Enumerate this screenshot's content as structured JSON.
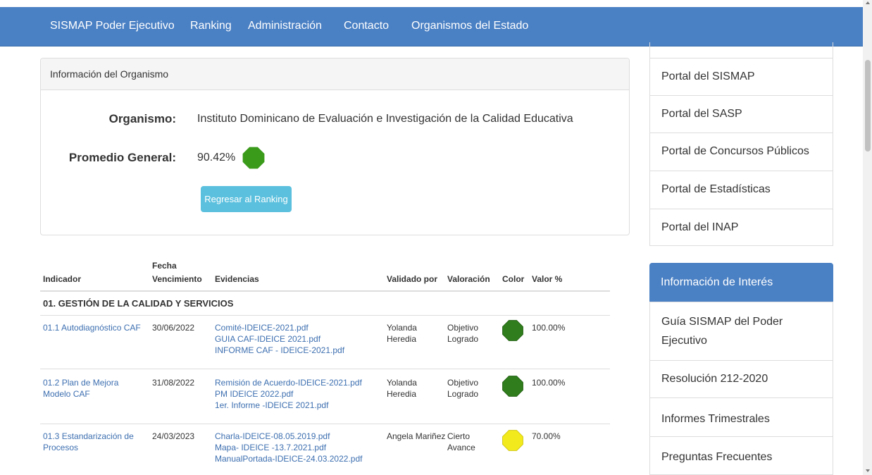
{
  "navbar": {
    "brand": "SISMAP Poder Ejecutivo",
    "items": [
      "Ranking",
      "Administración",
      "Contacto",
      "Organismos del Estado"
    ]
  },
  "info_panel": {
    "heading": "Información del Organismo",
    "org_label": "Organismo:",
    "org_value": "Instituto Dominicano de Evaluación e Investigación de la Calidad Educativa",
    "avg_label": "Promedio General:",
    "avg_value": "90.42%",
    "avg_color": "#3a9a1a",
    "back_button": "Regresar al Ranking"
  },
  "table": {
    "headers": {
      "indicador": "Indicador",
      "fecha_1": "Fecha",
      "fecha_2": "Vencimiento",
      "evidencias": "Evidencias",
      "validado": "Validado por",
      "valoracion": "Valoración",
      "color": "Color",
      "valor": "Valor %"
    },
    "section": "01. GESTIÓN DE LA CALIDAD Y SERVICIOS",
    "rows": [
      {
        "indicador": "01.1 Autodiagnóstico CAF",
        "fecha": "30/06/2022",
        "evidencias": [
          "Comité-IDEICE-2021.pdf",
          "GUIA CAF-IDEICE 2021.pdf",
          "INFORME CAF - IDEICE-2021.pdf"
        ],
        "validado_1": "Yolanda",
        "validado_2": "Heredia",
        "valoracion_1": "Objetivo",
        "valoracion_2": "Logrado",
        "color": "#2f7d1c",
        "valor": "100.00%"
      },
      {
        "indicador": "01.2 Plan de Mejora Modelo CAF",
        "fecha": "31/08/2022",
        "evidencias": [
          "Remisión de Acuerdo-IDEICE-2021.pdf",
          "PM IDEICE 2022.pdf",
          "1er. Informe -IDEICE 2021.pdf"
        ],
        "validado_1": "Yolanda",
        "validado_2": "Heredia",
        "valoracion_1": "Objetivo",
        "valoracion_2": "Logrado",
        "color": "#2f7d1c",
        "valor": "100.00%"
      },
      {
        "indicador": "01.3 Estandarización de Procesos",
        "fecha": "24/03/2023",
        "evidencias": [
          "Charla-IDEICE-08.05.2019.pdf",
          "Mapa- IDEICE -13.7.2021.pdf",
          "ManualPortada-IDEICE-24.03.2022.pdf"
        ],
        "validado_1": "Angela Mariñez",
        "validado_2": "",
        "valoracion_1": "Cierto",
        "valoracion_2": "Avance",
        "color": "#f2ea1c",
        "valor": "70.00%"
      }
    ]
  },
  "sidebar": {
    "portals": [
      "Portal del SISMAP",
      "Portal del SASP",
      "Portal de Concursos Públicos",
      "Portal de Estadísticas",
      "Portal del INAP"
    ],
    "interest_heading": "Información de Interés",
    "interest_items": [
      "Guía SISMAP del Poder Ejecutivo",
      "Resolución 212-2020",
      "Informes Trimestrales",
      "Preguntas Frecuentes"
    ]
  }
}
